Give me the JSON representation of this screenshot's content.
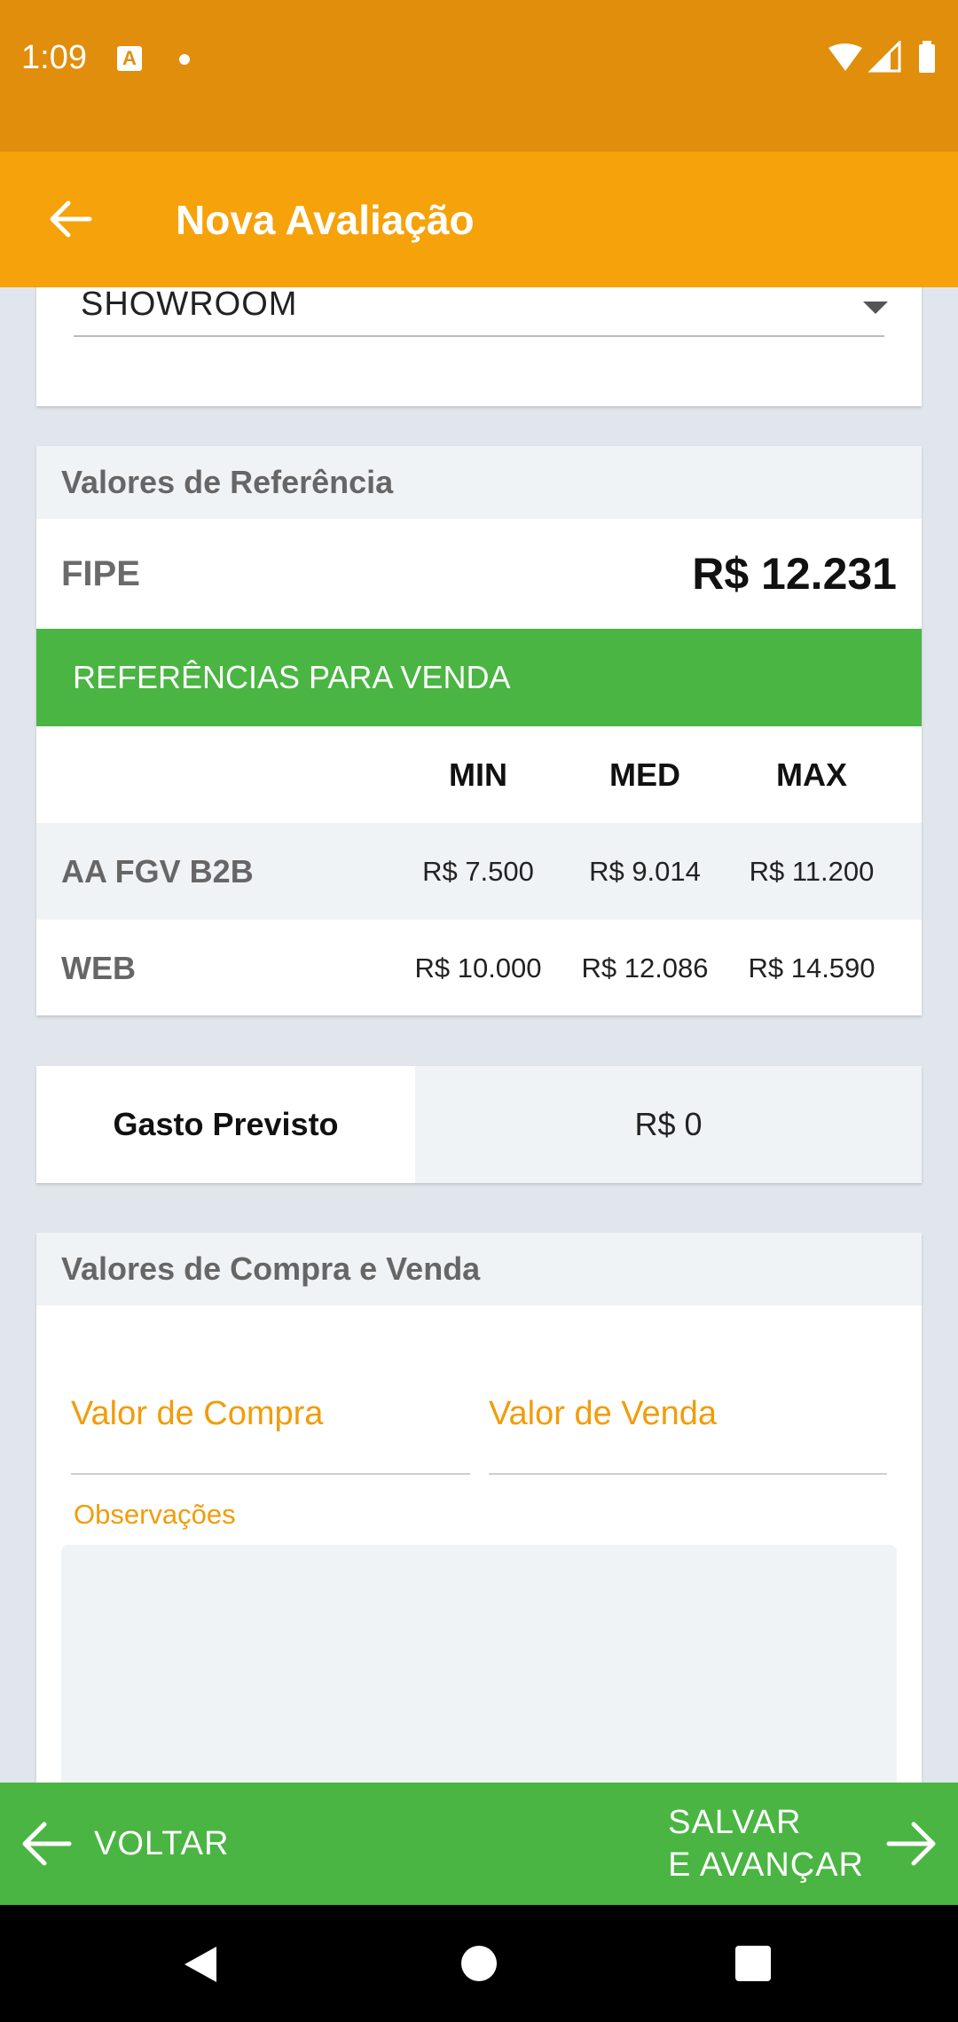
{
  "status_bar": {
    "time": "1:09",
    "notification_badge": "A"
  },
  "app_bar": {
    "title": "Nova Avaliação"
  },
  "showroom_select": {
    "selected": "SHOWROOM"
  },
  "valores_referencia": {
    "header": "Valores de Referência",
    "fipe_label": "FIPE",
    "fipe_value": "R$  12.231",
    "banner": "REFERÊNCIAS PARA VENDA",
    "columns": [
      "MIN",
      "MED",
      "MAX"
    ],
    "rows": [
      {
        "label": "AA FGV B2B",
        "min": "R$  7.500",
        "med": "R$  9.014",
        "max": "R$  11.200"
      },
      {
        "label": "WEB",
        "min": "R$  10.000",
        "med": "R$  12.086",
        "max": "R$  14.590"
      }
    ]
  },
  "gasto_previsto": {
    "label": "Gasto Previsto",
    "value": "R$  0"
  },
  "compra_venda": {
    "header": "Valores de Compra e Venda",
    "compra_placeholder": "Valor de Compra",
    "venda_placeholder": "Valor de Venda",
    "observacoes_label": "Observações"
  },
  "bottom_bar": {
    "voltar_label": "VOLTAR",
    "avancar_line1": "SALVAR",
    "avancar_line2": "E AVANÇAR"
  },
  "colors": {
    "status_bar": "#e08e0b",
    "app_bar": "#f6a20a",
    "accent_green": "#4ab542",
    "input_accent": "#f29c0a",
    "background": "#e1e6ec"
  },
  "icons": {
    "back": "arrow-left-icon",
    "wifi": "wifi-icon",
    "signal": "signal-icon",
    "battery": "battery-icon",
    "dropdown": "caret-down-icon",
    "voltar": "arrow-left-icon",
    "avancar": "arrow-right-icon",
    "nav_back": "triangle-back-icon",
    "nav_home": "circle-home-icon",
    "nav_recent": "square-recents-icon"
  }
}
